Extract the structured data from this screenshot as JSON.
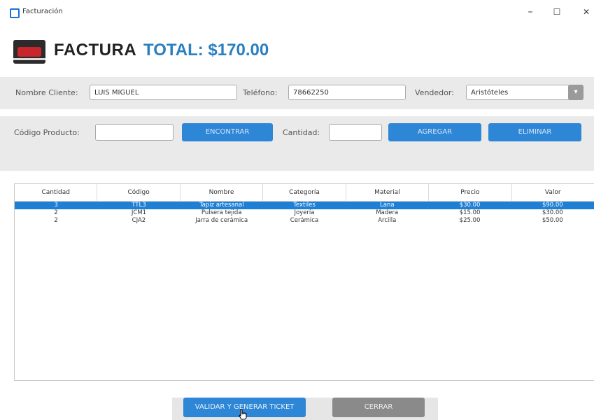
{
  "window": {
    "title": "Facturación",
    "minimize_glyph": "–",
    "maximize_glyph": "☐",
    "close_glyph": "✕"
  },
  "header": {
    "title": "FACTURA",
    "total": "TOTAL: $170.00"
  },
  "customer": {
    "name_label": "Nombre Cliente:",
    "name_value": "LUIS MIGUEL",
    "phone_label": "Teléfono:",
    "phone_value": "78662250",
    "seller_label": "Vendedor:",
    "seller_value": "Aristóteles",
    "seller_arrow": "▾"
  },
  "product": {
    "code_label": "Código Producto:",
    "code_value": "",
    "find_button": "ENCONTRAR",
    "qty_label": "Cantidad:",
    "qty_value": "",
    "add_button": "AGREGAR",
    "delete_button": "ELIMINAR"
  },
  "table": {
    "columns": [
      "Cantidad",
      "Código",
      "Nombre",
      "Categoría",
      "Material",
      "Precio",
      "Valor"
    ],
    "rows": [
      [
        "3",
        "TTL3",
        "Tapiz artesanal",
        "Textiles",
        "Lana",
        "$30.00",
        "$90.00"
      ],
      [
        "2",
        "JCM1",
        "Pulsera tejida",
        "Joyería",
        "Madera",
        "$15.00",
        "$30.00"
      ],
      [
        "2",
        "CJA2",
        "Jarra de cerámica",
        "Cerámica",
        "Arcilla",
        "$25.00",
        "$50.00"
      ]
    ],
    "selected_row": 0
  },
  "footer": {
    "validate_button": "VALIDAR Y GENERAR TICKET",
    "close_button": "CERRAR"
  },
  "colors": {
    "accent": "#2e86d6",
    "selection": "#1e7fd4",
    "total_text": "#2a7fbf",
    "panel_bg": "#eaeaea"
  }
}
